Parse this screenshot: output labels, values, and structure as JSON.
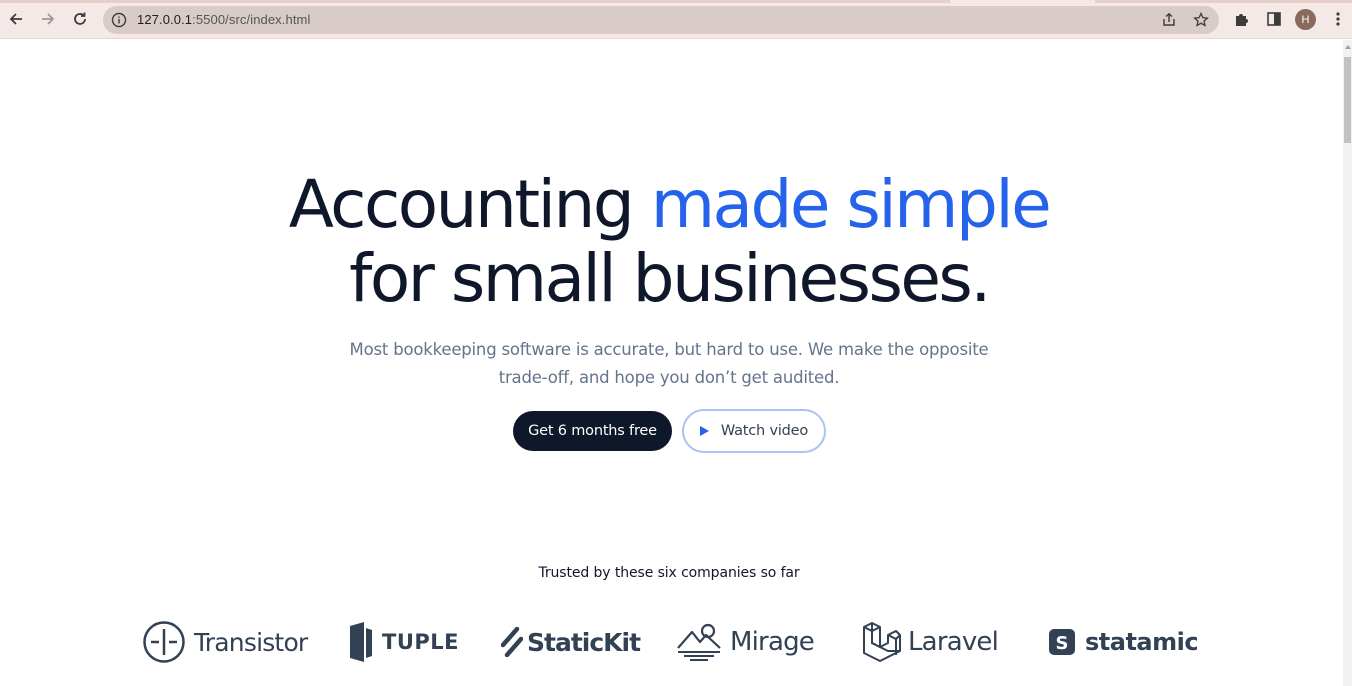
{
  "browser": {
    "url_host": "127.0.0.1",
    "url_path": ":5500/src/index.html",
    "avatar_initial": "H"
  },
  "hero": {
    "title_part1": "Accounting ",
    "title_accent": "made simple",
    "title_part2": "for small businesses.",
    "subtitle_line1": "Most bookkeeping software is accurate, but hard to use. We make the opposite",
    "subtitle_line2": "trade-off, and hope you don’t get audited.",
    "primary_cta": "Get 6 months free",
    "secondary_cta": "Watch video"
  },
  "trusted": {
    "heading": "Trusted by these six companies so far",
    "logos": [
      "Transistor",
      "TUPLE",
      "StaticKit",
      "Mirage",
      "Laravel",
      "statamic"
    ]
  },
  "colors": {
    "accent": "#2563eb",
    "dark": "#0f172a",
    "muted": "#64748b"
  }
}
